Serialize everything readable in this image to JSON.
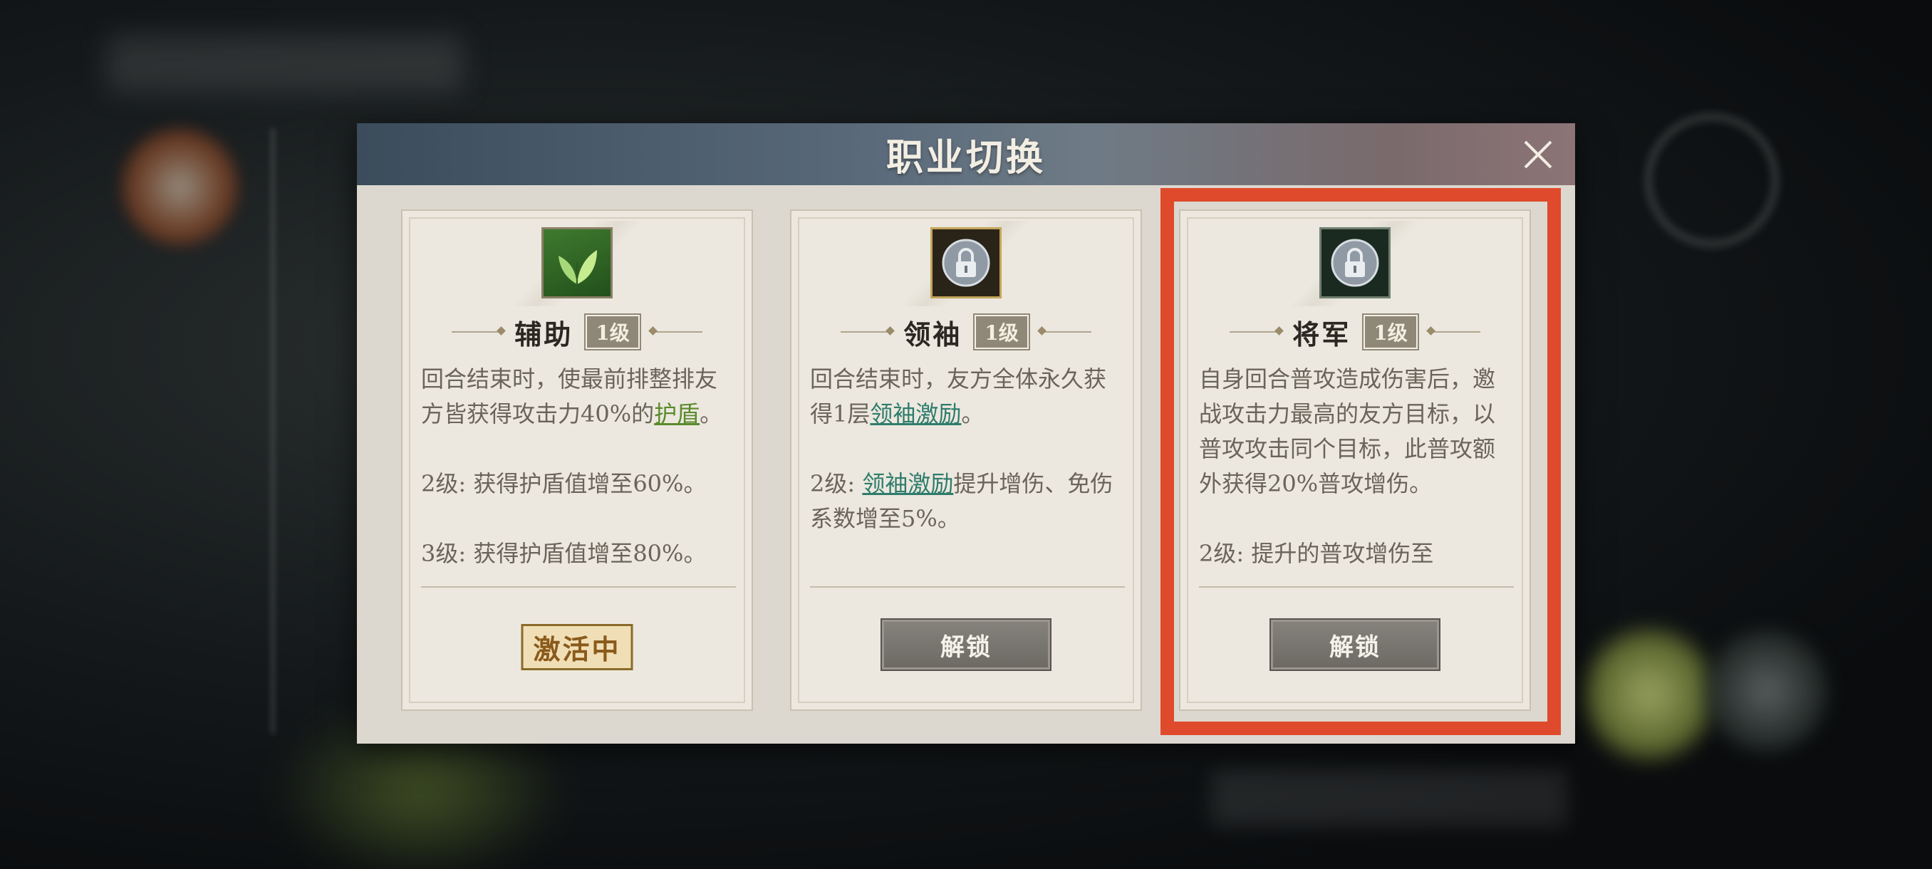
{
  "dialog": {
    "title": "职业切换",
    "close_icon": "close-x-icon"
  },
  "cards": [
    {
      "name": "辅助",
      "level": "1级",
      "icon": "leaf-icon",
      "desc_main_before": "回合结束时，使最前排整排友方皆获得攻击力40%的",
      "desc_main_link": "护盾",
      "desc_main_after": "。",
      "lv2": "2级: 获得护盾值增至60%。",
      "lv3": "3级: 获得护盾值增至80%。",
      "status": "激活中"
    },
    {
      "name": "领袖",
      "level": "1级",
      "icon": "lock-icon",
      "desc_main_before": "回合结束时，友方全体永久获得1层",
      "desc_main_link": "领袖激励",
      "desc_main_after": "。",
      "lv2_prefix": "2级: ",
      "lv2_link": "领袖激励",
      "lv2_after": "提升增伤、免伤系数增至5%。",
      "button": "解锁"
    },
    {
      "name": "将军",
      "level": "1级",
      "icon": "lock-icon",
      "desc_main": "自身回合普攻造成伤害后，邀战攻击力最高的友方目标，以普攻攻击同个目标，此普攻额外获得20%普攻增伤。",
      "lv2": "2级: 提升的普攻增伤至",
      "button": "解锁"
    }
  ],
  "colors": {
    "highlight": "#e04a2c",
    "link_green": "#5a8a2c",
    "link_teal": "#2e7c6c"
  }
}
